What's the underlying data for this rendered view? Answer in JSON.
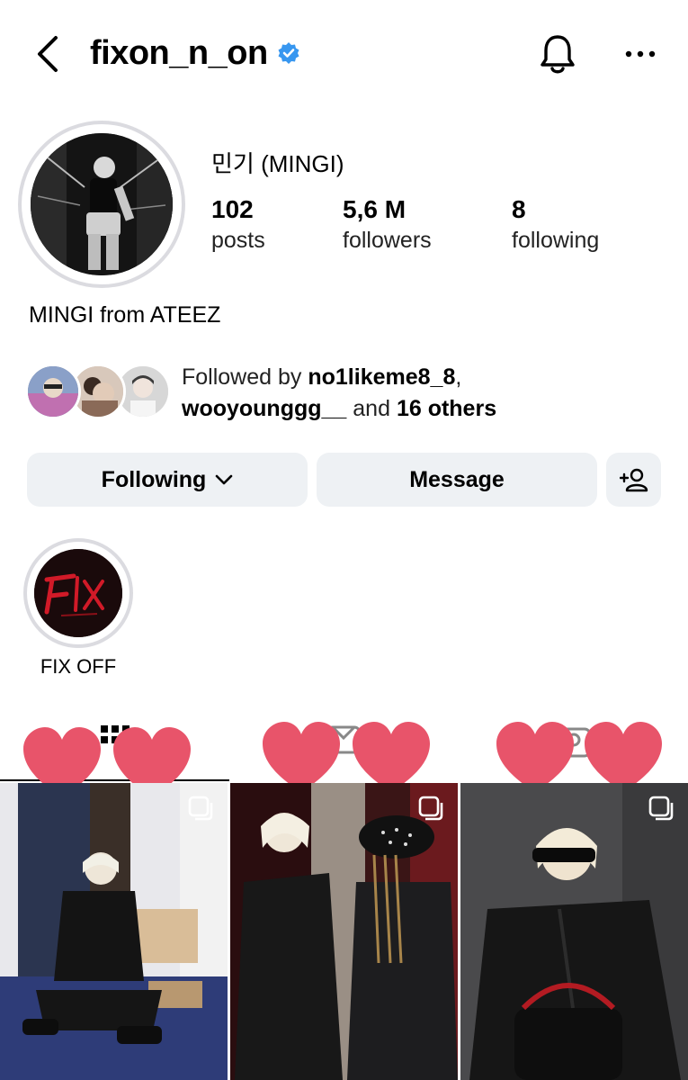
{
  "header": {
    "username": "fixon_n_on",
    "verified": true,
    "back_icon": "chevron-left-icon",
    "bell_icon": "bell-icon",
    "more_icon": "more-horizontal-icon"
  },
  "profile": {
    "full_name": "민기 (MINGI)",
    "stats": [
      {
        "value": "102",
        "label": "posts"
      },
      {
        "value": "5,6 M",
        "label": "followers"
      },
      {
        "value": "8",
        "label": "following"
      }
    ],
    "bio": "MINGI from ATEEZ"
  },
  "followed_by": {
    "prefix": "Followed by ",
    "user1": "no1likeme8_8",
    "separator": ",",
    "user2": "wooyounggg__",
    "middle": " and ",
    "others": "16 others"
  },
  "actions": {
    "following_label": "Following",
    "message_label": "Message",
    "add_user_icon": "add-person-icon"
  },
  "highlights": [
    {
      "label": "FIX OFF"
    }
  ],
  "tabs": [
    {
      "icon": "grid-icon",
      "active": true
    },
    {
      "icon": "reels-icon",
      "active": false
    },
    {
      "icon": "tagged-icon",
      "active": false
    }
  ],
  "accent_colors": {
    "verified": "#3897f0",
    "heart": "#e8546a",
    "button_bg": "#eef1f4"
  }
}
